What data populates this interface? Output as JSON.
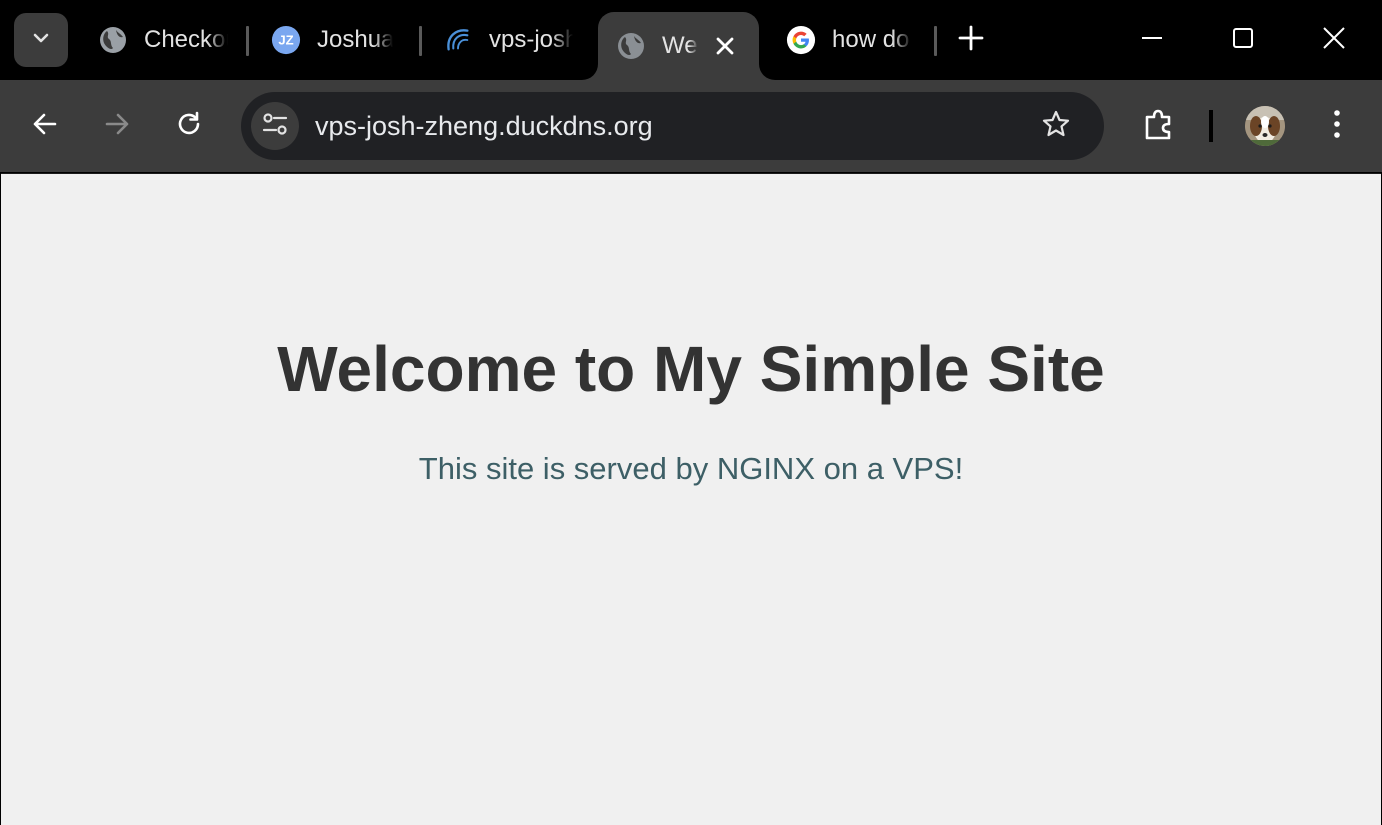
{
  "tabs": [
    {
      "title": "Checkout",
      "icon": "globe-icon"
    },
    {
      "title": "Joshua Zheng",
      "icon": "jz-logo-icon"
    },
    {
      "title": "vps-josh-zheng",
      "icon": "arc-logo-icon"
    },
    {
      "title": "Welcome",
      "icon": "globe-icon",
      "active": true
    },
    {
      "title": "how do",
      "icon": "google-icon"
    }
  ],
  "omnibox": {
    "url": "vps-josh-zheng.duckdns.org"
  },
  "page": {
    "heading": "Welcome to My Simple Site",
    "subtitle": "This site is served by NGINX on a VPS!"
  },
  "colors": {
    "tabstrip_bg": "#000000",
    "toolbar_bg": "#3c3c3c",
    "omnibox_bg": "#202124",
    "page_bg": "#f0f0f0",
    "heading_color": "#333333",
    "subtitle_color": "#3d5f66"
  }
}
